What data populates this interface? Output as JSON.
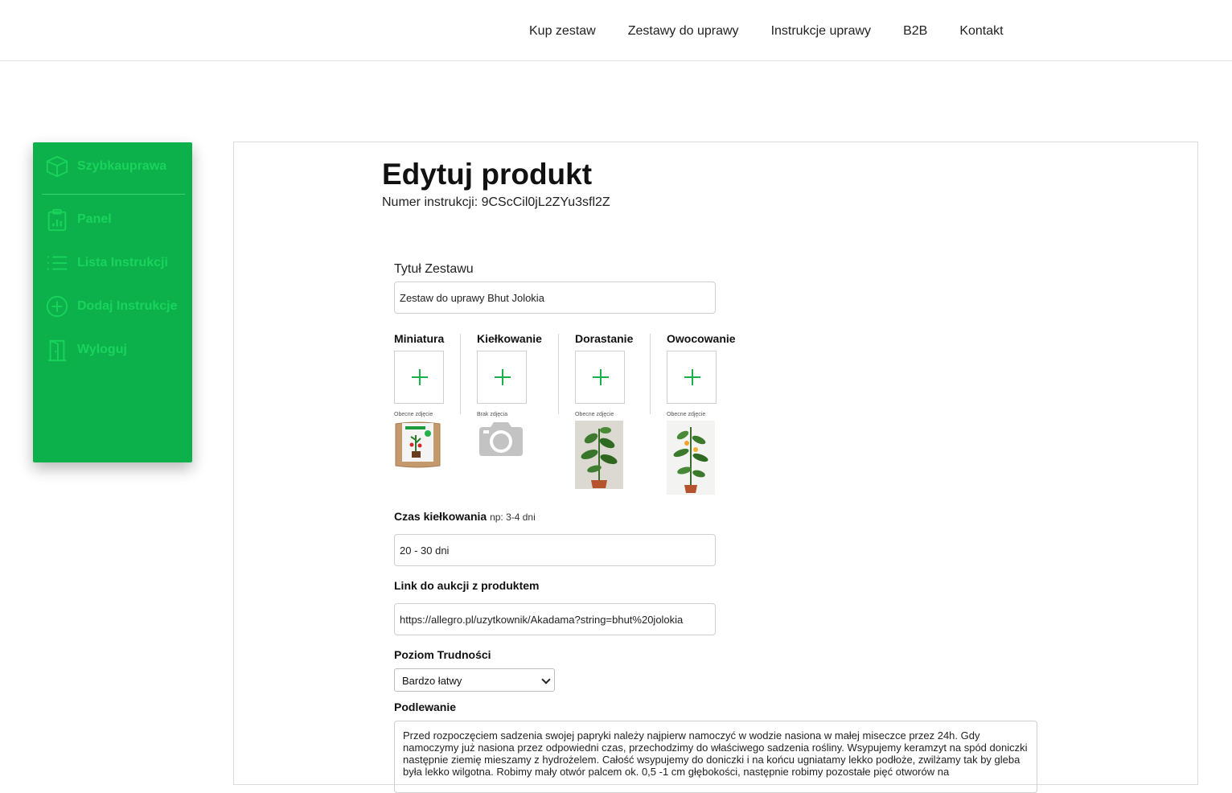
{
  "topnav": {
    "links": [
      "Kup zestaw",
      "Zestawy do uprawy",
      "Instrukcje uprawy",
      "B2B",
      "Kontakt"
    ]
  },
  "sidebar": {
    "brand": "Szybkauprawa",
    "items": [
      {
        "label": "Panel",
        "icon": "clipboard-chart-icon"
      },
      {
        "label": "Lista Instrukcji",
        "icon": "list-icon"
      },
      {
        "label": "Dodaj Instrukcje",
        "icon": "plus-circle-icon"
      },
      {
        "label": "Wyloguj",
        "icon": "door-icon"
      }
    ],
    "colors": {
      "background": "#0db14b",
      "text": "#19d35c"
    }
  },
  "main": {
    "title": "Edytuj produkt",
    "instruction_label": "Numer instrukcji:",
    "instruction_number": "9CScCil0jL2ZYu3sfl2Z",
    "set_title_label": "Tytuł Zestawu",
    "set_title_value": "Zestaw do uprawy Bhut Jolokia",
    "images": [
      {
        "title": "Miniatura",
        "caption": "Obecne zdjęcie"
      },
      {
        "title": "Kiełkowanie",
        "caption": "Brak zdjęcia"
      },
      {
        "title": "Dorastanie",
        "caption": "Obecne zdjęcie"
      },
      {
        "title": "Owocowanie",
        "caption": "Obecne zdjęcie"
      }
    ],
    "germination_label": "Czas kiełkowania",
    "germination_hint": "np: 3-4 dni",
    "germination_value": "20 - 30 dni",
    "link_label": "Link do aukcji z produktem",
    "link_value": "https://allegro.pl/uzytkownik/Akadama?string=bhut%20jolokia",
    "difficulty_label": "Poziom Trudności",
    "difficulty_value": "Bardzo łatwy",
    "watering_label": "Podlewanie",
    "watering_text": "Przed rozpoczęciem sadzenia swojej papryki należy najpierw namoczyć w wodzie nasiona w małej miseczce przez 24h. Gdy namoczymy już nasiona przez odpowiedni czas, przechodzimy do właściwego sadzenia rośliny. Wsypujemy keramzyt na spód doniczki następnie ziemię mieszamy z hydrożelem. Całość wsypujemy do doniczki i na końcu ugniatamy lekko podłoże, zwilżamy tak by gleba była lekko wilgotna. Robimy mały otwór palcem ok. 0,5 -1 cm głębokości, następnie robimy pozostałe pięć otworów na"
  }
}
